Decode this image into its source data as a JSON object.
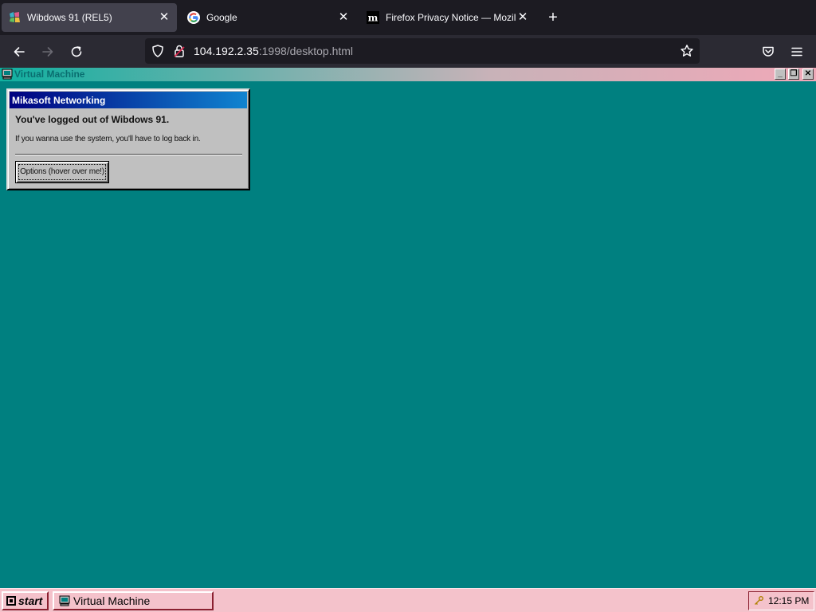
{
  "browser": {
    "tabs": [
      {
        "title": "Wibdows 91 (REL5)",
        "active": true,
        "favicon": "wibdows-logo-icon"
      },
      {
        "title": "Google",
        "active": false,
        "favicon": "google-g-icon"
      },
      {
        "title": "Firefox Privacy Notice — Mozilla",
        "active": false,
        "favicon": "mozilla-m-icon"
      }
    ],
    "tab_close_glyph": "✕",
    "new_tab_glyph": "+",
    "url": {
      "host": "104.192.2.35",
      "rest": ":1998/desktop.html"
    },
    "nav_icons": [
      "back-arrow-icon",
      "forward-arrow-icon",
      "reload-icon",
      "shield-icon",
      "lock-icon",
      "bookmark-star-icon",
      "pocket-icon",
      "hamburger-menu-icon"
    ]
  },
  "vm_window": {
    "title": "Virtual Machine",
    "controls": {
      "minimize": "_",
      "restore": "❐",
      "close": "✕"
    }
  },
  "dialog": {
    "title": "Mikasoft Networking",
    "heading": "You've logged out of Wibdows 91.",
    "message": "If you wanna use the system, you'll have to log back in.",
    "button_label": "Options (hover over me!)"
  },
  "taskbar": {
    "start_label": "start",
    "task_label": "Virtual Machine",
    "clock": "12:15 PM"
  },
  "colors": {
    "desktop": "#008080",
    "taskbar": "#f4c2cb",
    "dialog_title_start": "#000080",
    "dialog_title_end": "#1084d0"
  }
}
